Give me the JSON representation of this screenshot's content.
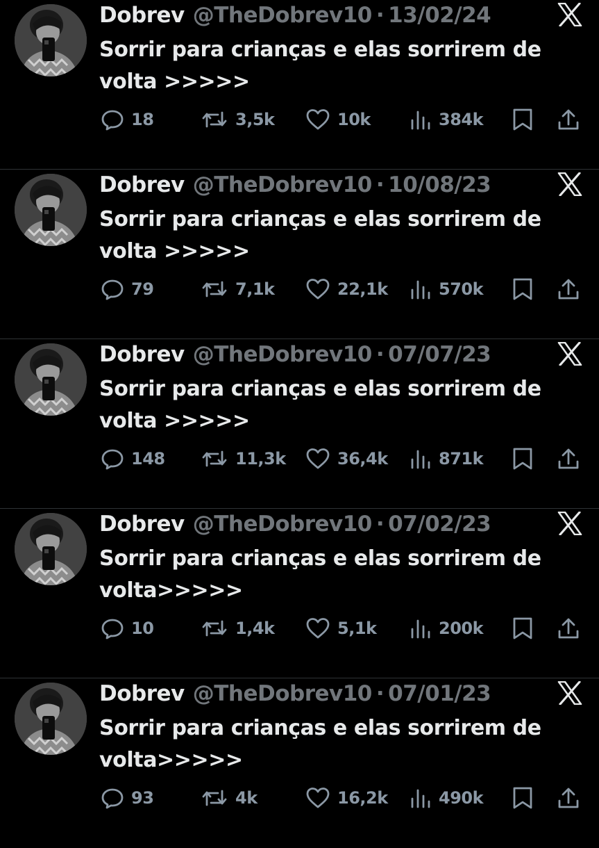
{
  "icons": {
    "reply": "reply-icon",
    "retweet": "retweet-icon",
    "like": "heart-icon",
    "views": "views-icon",
    "bookmark": "bookmark-icon",
    "share": "share-icon",
    "x": "x-logo-icon"
  },
  "colors": {
    "background": "#000000",
    "text": "#e7e9ea",
    "muted": "#71767b",
    "divider": "#2f3336"
  },
  "tweets": [
    {
      "name": "Dobrev",
      "handle": "@TheDobrev10",
      "separator": "·",
      "date": "13/02/24",
      "text_line1": "Sorrir para crianças e elas sorrirem de",
      "text_line2": "volta >>>>>",
      "replies": "18",
      "retweets": "3,5k",
      "likes": "10k",
      "views": "384k"
    },
    {
      "name": "Dobrev",
      "handle": "@TheDobrev10",
      "separator": "·",
      "date": "10/08/23",
      "text_line1": "Sorrir para crianças e elas sorrirem de",
      "text_line2": "volta >>>>>",
      "replies": "79",
      "retweets": "7,1k",
      "likes": "22,1k",
      "views": "570k"
    },
    {
      "name": "Dobrev",
      "handle": "@TheDobrev10",
      "separator": "·",
      "date": "07/07/23",
      "text_line1": "Sorrir para crianças e elas sorrirem de",
      "text_line2": "volta >>>>>",
      "replies": "148",
      "retweets": "11,3k",
      "likes": "36,4k",
      "views": "871k"
    },
    {
      "name": "Dobrev",
      "handle": "@TheDobrev10",
      "separator": "·",
      "date": "07/02/23",
      "text_line1": "Sorrir para crianças e elas sorrirem de",
      "text_line2": "volta>>>>>",
      "replies": "10",
      "retweets": "1,4k",
      "likes": "5,1k",
      "views": "200k"
    },
    {
      "name": "Dobrev",
      "handle": "@TheDobrev10",
      "separator": "·",
      "date": "07/01/23",
      "text_line1": "Sorrir para crianças e elas sorrirem de",
      "text_line2": "volta>>>>>",
      "replies": "93",
      "retweets": "4k",
      "likes": "16,2k",
      "views": "490k"
    }
  ]
}
